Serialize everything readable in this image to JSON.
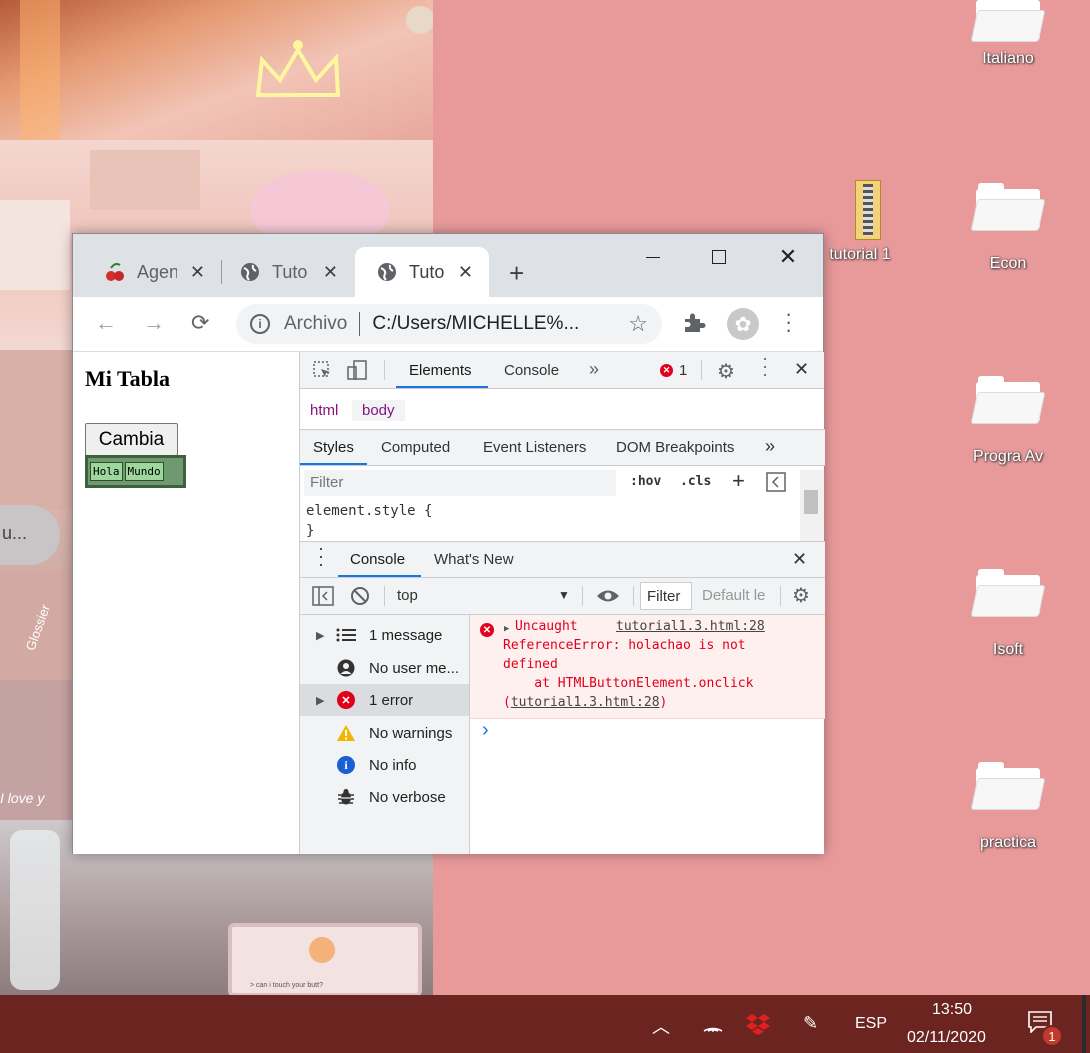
{
  "desktop": {
    "icons": [
      {
        "label": "Italiano"
      },
      {
        "label": "tutorial 1"
      },
      {
        "label": "Econ"
      },
      {
        "label": "Progra Av"
      },
      {
        "label": "Isoft"
      },
      {
        "label": "practica"
      }
    ],
    "wallpaper": {
      "left_snippet": "u...",
      "love_text": "I love y",
      "brand_text": "Glossier",
      "card_text": "> can i touch your butt?"
    }
  },
  "browser": {
    "tabs": [
      {
        "label": "Agen",
        "icon": "cherry-icon"
      },
      {
        "label": "Tuto",
        "icon": "globe-icon"
      },
      {
        "label": "Tuto",
        "icon": "globe-icon",
        "active": true
      }
    ],
    "address": {
      "security_label": "Archivo",
      "url": "C:/Users/MICHELLE%..."
    },
    "page": {
      "heading": "Mi Tabla",
      "button_label": "Cambia",
      "table_cells": [
        "Hola",
        "Mundo"
      ]
    },
    "devtools": {
      "main_tabs": [
        "Elements",
        "Console"
      ],
      "error_count": "1",
      "breadcrumbs": [
        "html",
        "body"
      ],
      "styles_tabs": [
        "Styles",
        "Computed",
        "Event Listeners",
        "DOM Breakpoints"
      ],
      "filter_placeholder": "Filter",
      "hov_label": ":hov",
      "cls_label": ".cls",
      "element_style": "element.style {",
      "element_style_close": "}",
      "drawer_tabs": [
        "Console",
        "What's New"
      ],
      "context": "top",
      "console_filter_placeholder": "Filter",
      "levels_label": "Default le",
      "sidebar": [
        {
          "label": "1 message",
          "icon": "list-icon",
          "expandable": true
        },
        {
          "label": "No user me...",
          "icon": "user-icon",
          "expandable": false
        },
        {
          "label": "1 error",
          "icon": "error-icon",
          "expandable": true,
          "selected": true
        },
        {
          "label": "No warnings",
          "icon": "warning-icon",
          "expandable": false
        },
        {
          "label": "No info",
          "icon": "info-icon",
          "expandable": false
        },
        {
          "label": "No verbose",
          "icon": "bug-icon",
          "expandable": false
        }
      ],
      "error": {
        "prefix": "Uncaught",
        "source": "tutorial1.3.html:28",
        "line1": "ReferenceError: holachao is not",
        "line2": "defined",
        "line3": "    at HTMLButtonElement.onclick",
        "line4_open": "(",
        "line4_link": "tutorial1.3.html:28",
        "line4_close": ")"
      },
      "prompt": "›"
    }
  },
  "taskbar": {
    "language": "ESP",
    "time": "13:50",
    "date": "02/11/2020",
    "notification_count": "1"
  }
}
